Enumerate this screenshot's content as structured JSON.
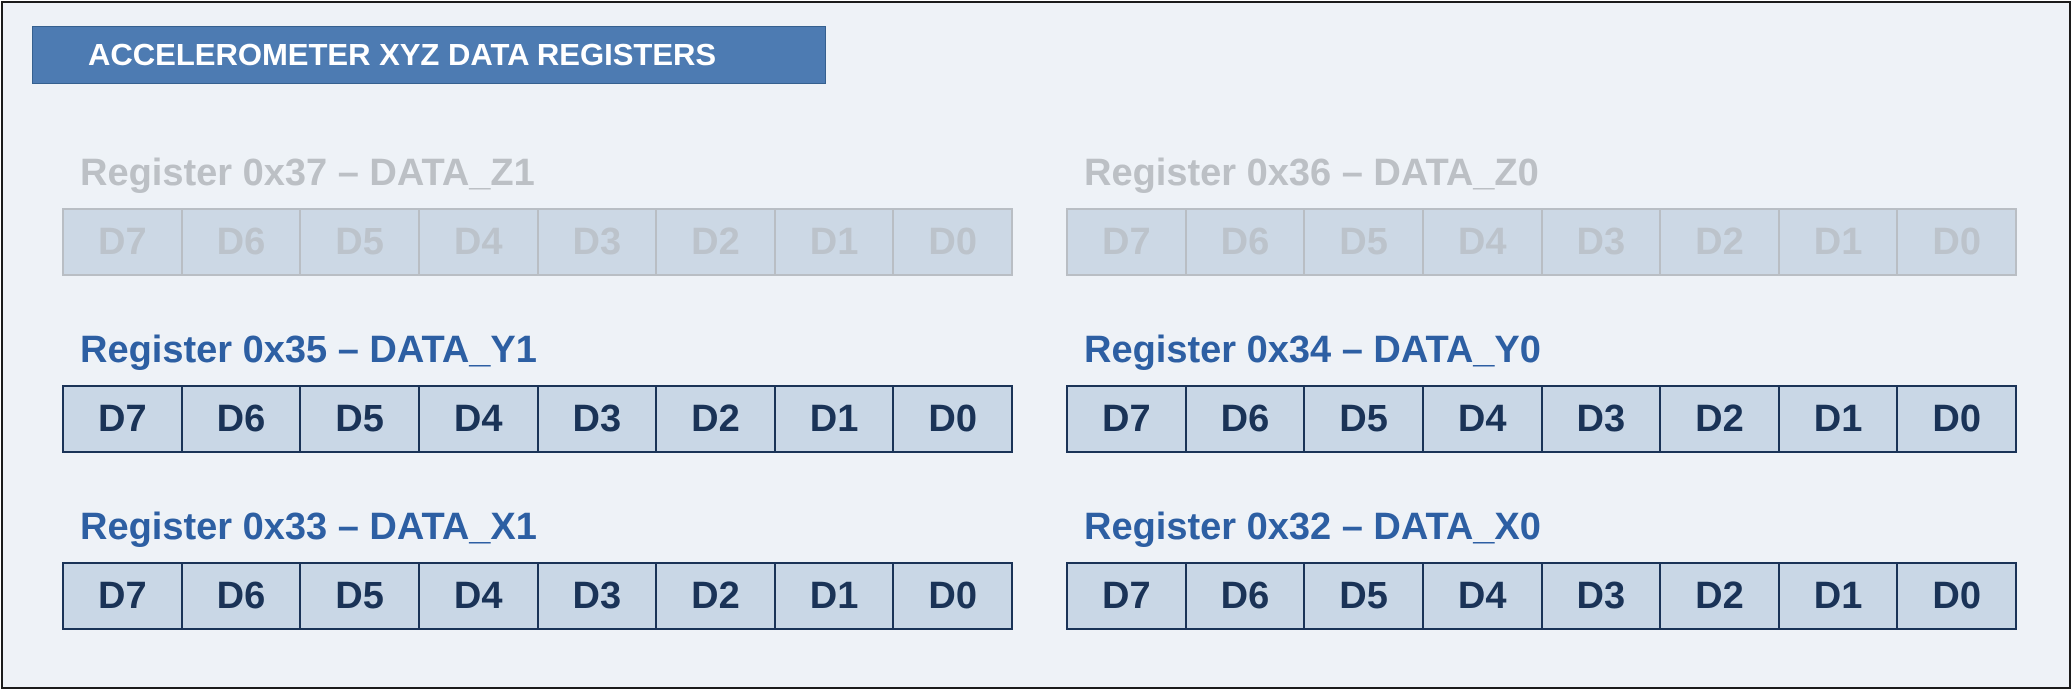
{
  "title": "ACCELEROMETER XYZ DATA REGISTERS",
  "registers": [
    {
      "label": "Register 0x37 – DATA_Z1",
      "bits": [
        "D7",
        "D6",
        "D5",
        "D4",
        "D3",
        "D2",
        "D1",
        "D0"
      ]
    },
    {
      "label": "Register 0x36 – DATA_Z0",
      "bits": [
        "D7",
        "D6",
        "D5",
        "D4",
        "D3",
        "D2",
        "D1",
        "D0"
      ]
    },
    {
      "label": "Register 0x35 – DATA_Y1",
      "bits": [
        "D7",
        "D6",
        "D5",
        "D4",
        "D3",
        "D2",
        "D1",
        "D0"
      ]
    },
    {
      "label": "Register 0x34 – DATA_Y0",
      "bits": [
        "D7",
        "D6",
        "D5",
        "D4",
        "D3",
        "D2",
        "D1",
        "D0"
      ]
    },
    {
      "label": "Register 0x33 – DATA_X1",
      "bits": [
        "D7",
        "D6",
        "D5",
        "D4",
        "D3",
        "D2",
        "D1",
        "D0"
      ]
    },
    {
      "label": "Register 0x32 – DATA_X0",
      "bits": [
        "D7",
        "D6",
        "D5",
        "D4",
        "D3",
        "D2",
        "D1",
        "D0"
      ]
    }
  ],
  "colors": {
    "title_bar": "#4d7bb2",
    "active_label": "#2d5fa3",
    "active_text": "#1a3357",
    "cell_fill": "#c9d7e6",
    "dimmed_text": "#bcc0c5",
    "panel_background": "#eef2f7"
  }
}
